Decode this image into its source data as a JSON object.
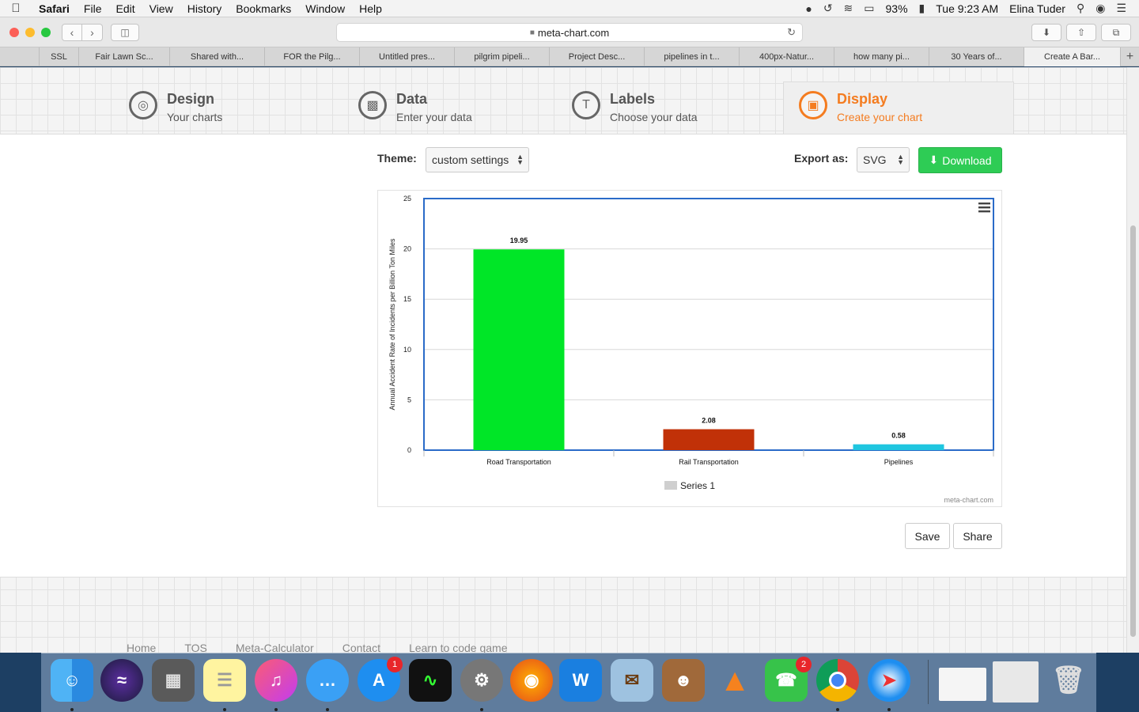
{
  "menubar": {
    "app": "Safari",
    "items": [
      "File",
      "Edit",
      "View",
      "History",
      "Bookmarks",
      "Window",
      "Help"
    ],
    "battery": "93%",
    "clock": "Tue 9:23 AM",
    "user": "Elina Tuder"
  },
  "browser": {
    "url": "meta-chart.com",
    "tabs": [
      "SSL",
      "Fair Lawn Sc...",
      "Shared with...",
      "FOR the Pilg...",
      "Untitled pres...",
      "pilgrim pipeli...",
      "Project Desc...",
      "pipelines in t...",
      "400px-Natur...",
      "how many pi...",
      "30 Years of...",
      "Create A Bar..."
    ],
    "active_tab": 11
  },
  "steps": [
    {
      "title": "Design",
      "subtitle": "Your charts",
      "icon": "palette-icon"
    },
    {
      "title": "Data",
      "subtitle": "Enter your data",
      "icon": "bar-chart-icon"
    },
    {
      "title": "Labels",
      "subtitle": "Choose your data",
      "icon": "text-icon"
    },
    {
      "title": "Display",
      "subtitle": "Create your chart",
      "icon": "display-icon"
    }
  ],
  "controls": {
    "theme_label": "Theme:",
    "theme_value": "custom settings",
    "export_label": "Export as:",
    "export_value": "SVG",
    "download_label": "Download"
  },
  "chart_data": {
    "type": "bar",
    "categories": [
      "Road Transportation",
      "Rail Transportation",
      "Pipelines"
    ],
    "values": [
      19.95,
      2.08,
      0.58
    ],
    "value_labels": [
      "19.95",
      "2.08",
      "0.58"
    ],
    "colors": [
      "#00e627",
      "#c13108",
      "#1fc6e0"
    ],
    "ylabel": "Annual Accident Rate of Incidents per Billion Ton Miles",
    "ylim": [
      0,
      25
    ],
    "yticks": [
      "0",
      "5",
      "10",
      "15",
      "20",
      "25"
    ],
    "series": [
      {
        "name": "Series 1",
        "values": [
          19.95,
          2.08,
          0.58
        ]
      }
    ],
    "grid": true,
    "legend": "bottom-center",
    "credit": "meta-chart.com"
  },
  "actions": {
    "save": "Save",
    "share": "Share"
  },
  "footer": {
    "links": [
      "Home",
      "TOS",
      "Meta-Calculator",
      "Contact",
      "Learn to code game"
    ]
  },
  "dock": {
    "badges": {
      "app_store": "1",
      "facetime": "2"
    }
  }
}
